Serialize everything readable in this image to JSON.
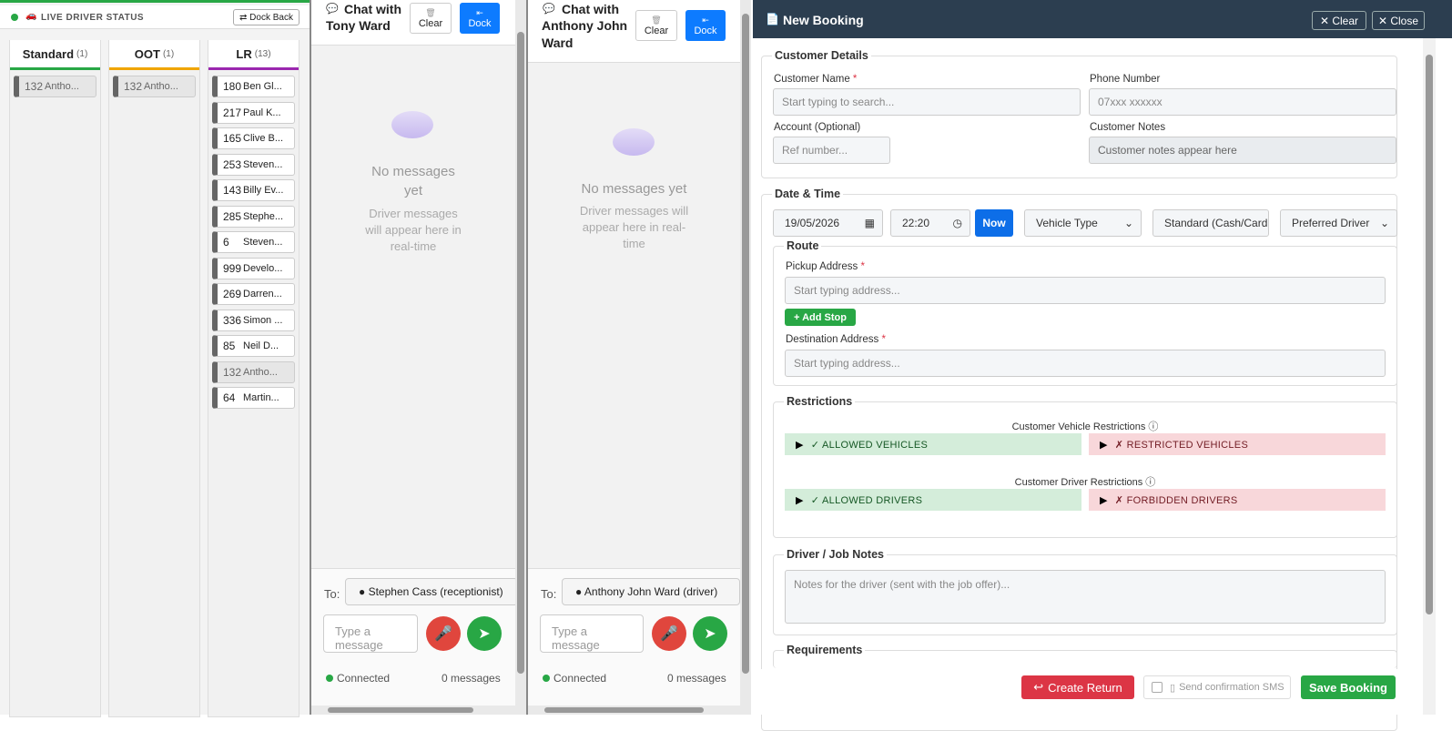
{
  "driver_status": {
    "title": "LIVE DRIVER STATUS",
    "dock_back": "⇄ Dock Back",
    "columns": [
      {
        "name": "Standard",
        "count": "(1)",
        "color": "#28a745",
        "drivers": [
          {
            "num": "132",
            "name": "Antho...",
            "busy": true
          }
        ]
      },
      {
        "name": "OOT",
        "count": "(1)",
        "color": "#f0a500",
        "drivers": [
          {
            "num": "132",
            "name": "Antho...",
            "busy": true
          }
        ]
      },
      {
        "name": "LR",
        "count": "(13)",
        "color": "#9b27af",
        "drivers": [
          {
            "num": "180",
            "name": "Ben Gl...",
            "busy": false
          },
          {
            "num": "217",
            "name": "Paul K...",
            "busy": false
          },
          {
            "num": "165",
            "name": "Clive B...",
            "busy": false
          },
          {
            "num": "253",
            "name": "Steven...",
            "busy": false
          },
          {
            "num": "143",
            "name": "Billy Ev...",
            "busy": false
          },
          {
            "num": "285",
            "name": "Stephe...",
            "busy": false
          },
          {
            "num": "6",
            "name": "Steven...",
            "busy": false
          },
          {
            "num": "999",
            "name": "Develo...",
            "busy": false
          },
          {
            "num": "269",
            "name": "Darren...",
            "busy": false
          },
          {
            "num": "336",
            "name": "Simon ...",
            "busy": false
          },
          {
            "num": "85",
            "name": "Neil D...",
            "busy": false
          },
          {
            "num": "132",
            "name": "Antho...",
            "busy": true
          },
          {
            "num": "64",
            "name": "Martin...",
            "busy": false
          }
        ]
      }
    ]
  },
  "chat1": {
    "title_line1": "Chat with",
    "title_line2": "Tony Ward",
    "clear": "Clear",
    "dock": "Dock",
    "no_msg_line1": "No messages",
    "no_msg_line2": "yet",
    "sub_line1": "Driver messages",
    "sub_line2": "will appear here in",
    "sub_line3": "real-time",
    "to_label": "To:",
    "to_value": "● Stephen Cass (receptionist)",
    "placeholder": "Type a message",
    "status": "Connected",
    "count": "0 messages"
  },
  "chat2": {
    "title_line1": "Chat with",
    "title_line2": "Anthony John",
    "title_line3": "Ward",
    "clear": "Clear",
    "dock": "Dock",
    "no_msg": "No messages yet",
    "sub_line1": "Driver messages will",
    "sub_line2": "appear here in real-",
    "sub_line3": "time",
    "to_label": "To:",
    "to_value": "● Anthony John Ward (driver)",
    "placeholder": "Type a message",
    "status": "Connected",
    "count": "0 messages"
  },
  "booking": {
    "title": "New Booking",
    "clear": "✕ Clear",
    "close": "✕ Close",
    "customer": {
      "legend": "Customer Details",
      "name_label": "Customer Name",
      "name_placeholder": "Start typing to search...",
      "phone_label": "Phone Number",
      "phone_placeholder": "07xxx xxxxxx",
      "account_label": "Account (Optional)",
      "account_placeholder": "Ref number...",
      "notes_label": "Customer Notes",
      "notes_placeholder": "Customer notes appear here"
    },
    "datetime": {
      "legend": "Date & Time",
      "date": "19/05/2026",
      "time": "22:20",
      "now": "Now",
      "vehicle_type": "Vehicle Type",
      "payment": "Standard (Cash/Card",
      "preferred_driver": "Preferred Driver"
    },
    "route": {
      "legend": "Route",
      "pickup_label": "Pickup Address",
      "pickup_placeholder": "Start typing address...",
      "add_stop": "+ Add Stop",
      "dest_label": "Destination Address",
      "dest_placeholder": "Start typing address..."
    },
    "restrictions": {
      "legend": "Restrictions",
      "vehicle_title": "Customer Vehicle Restrictions ⓘ",
      "allowed_vehicles": "✓ ALLOWED VEHICLES",
      "restricted_vehicles": "✗ RESTRICTED VEHICLES",
      "driver_title": "Customer Driver Restrictions ⓘ",
      "allowed_drivers": "✓ ALLOWED DRIVERS",
      "forbidden_drivers": "✗ FORBIDDEN DRIVERS"
    },
    "notes": {
      "legend": "Driver / Job Notes",
      "placeholder": "Notes for the driver (sent with the job offer)..."
    },
    "requirements": {
      "legend": "Requirements"
    },
    "footer": {
      "create_return": "Create Return",
      "sms": "Send confirmation SMS",
      "save": "Save Booking"
    }
  },
  "colors": {
    "green": "#28a745",
    "blue": "#0d7bff",
    "red": "#dc3545",
    "navy": "#2c3e50"
  }
}
